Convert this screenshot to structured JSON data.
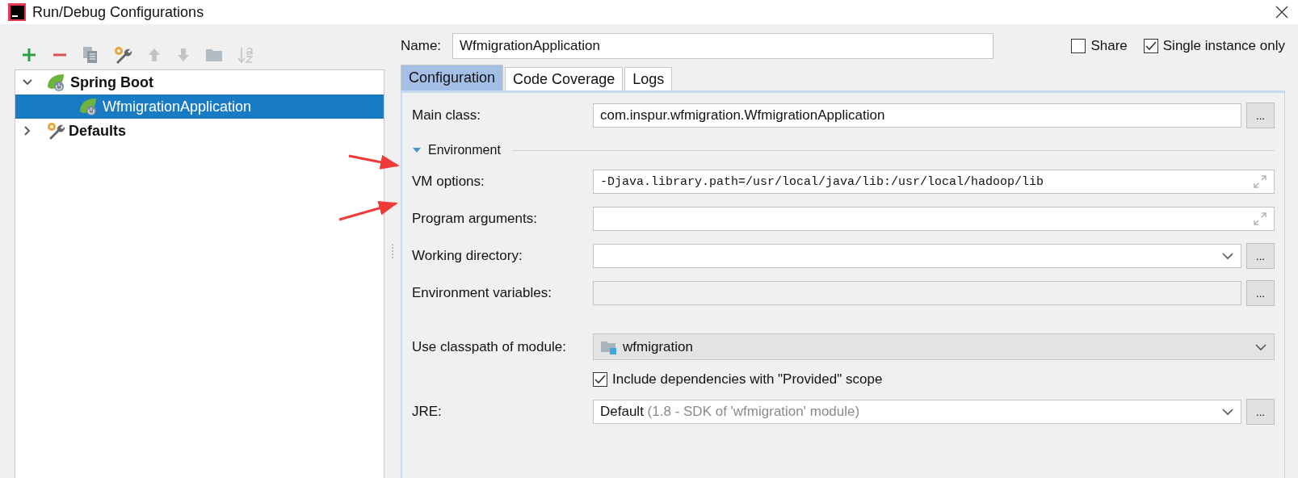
{
  "window": {
    "title": "Run/Debug Configurations"
  },
  "tree": [
    {
      "label": "Spring Boot",
      "kind": "spring",
      "expanded": true,
      "selected": false,
      "children": [
        {
          "label": "WfmigrationApplication",
          "kind": "spring",
          "selected": true
        }
      ]
    },
    {
      "label": "Defaults",
      "kind": "defaults",
      "expanded": false,
      "selected": false
    }
  ],
  "name": {
    "label": "Name:",
    "value": "WfmigrationApplication"
  },
  "options": [
    {
      "label": "Share",
      "checked": false
    },
    {
      "label": "Single instance only",
      "checked": true
    }
  ],
  "tabs": [
    {
      "label": "Configuration",
      "selected": true
    },
    {
      "label": "Code Coverage",
      "selected": false
    },
    {
      "label": "Logs",
      "selected": false
    }
  ],
  "form": [
    {
      "kind": "field",
      "label": "Main class:",
      "value": "com.inspur.wfmigration.WfmigrationApplication",
      "browse": "..."
    },
    {
      "kind": "section",
      "label": "Environment",
      "expanded": true
    },
    {
      "kind": "multiline",
      "label": "VM options:",
      "value": "-Djava.library.path=/usr/local/java/lib:/usr/local/hadoop/lib"
    },
    {
      "kind": "multiline",
      "label": "Program arguments:"
    },
    {
      "kind": "combo",
      "label": "Working directory:",
      "browse": "..."
    },
    {
      "kind": "field",
      "label": "Environment variables:",
      "disabled": true,
      "browse": "..."
    },
    {
      "kind": "module",
      "label": "Use classpath of module:",
      "value": "wfmigration"
    },
    {
      "kind": "checkbox",
      "label": "Include dependencies with \"Provided\" scope",
      "checked": true
    },
    {
      "kind": "combo",
      "label": "JRE:",
      "value": "Default",
      "hint": "(1.8 - SDK of 'wfmigration' module)",
      "browse": "..."
    }
  ]
}
